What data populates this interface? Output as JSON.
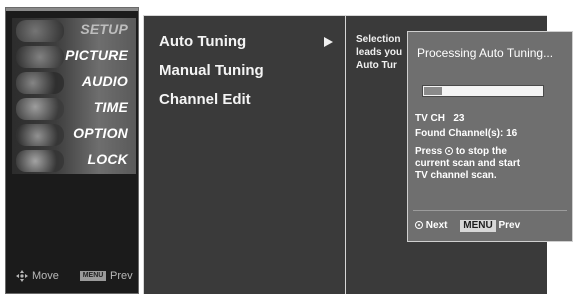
{
  "sidebar": {
    "items": [
      {
        "label": "SETUP",
        "active": false
      },
      {
        "label": "PICTURE",
        "active": true
      },
      {
        "label": "AUDIO",
        "active": true
      },
      {
        "label": "TIME",
        "active": true
      },
      {
        "label": "OPTION",
        "active": true
      },
      {
        "label": "LOCK",
        "active": true
      }
    ],
    "footer": {
      "move_label": "Move",
      "menu_icon_label": "MENU",
      "prev_label": "Prev"
    }
  },
  "tuning_menu": {
    "items": [
      "Auto Tuning",
      "Manual Tuning",
      "Channel Edit"
    ],
    "selected": "Auto Tuning"
  },
  "help_panel": {
    "text": "Selection\nleads you\nAuto Tur"
  },
  "popup": {
    "title": "Processing Auto Tuning...",
    "progress": 0.15,
    "channel_label": "TV CH",
    "channel_value": "23",
    "found_label": "Found Channel(s):",
    "found_value": "16",
    "press_word": "Press",
    "press_line1_rest": "to stop the",
    "press_line2": "current scan and start",
    "press_line3": "TV channel  scan.",
    "next_label": "Next",
    "menu_button": "MENU",
    "prev_label": "Prev"
  },
  "colors": {
    "panel_bg": "#3a3a3a",
    "popup_bg": "#6f6f6f",
    "sidebar_bg": "#1b1b1b",
    "text": "#ffffff"
  }
}
